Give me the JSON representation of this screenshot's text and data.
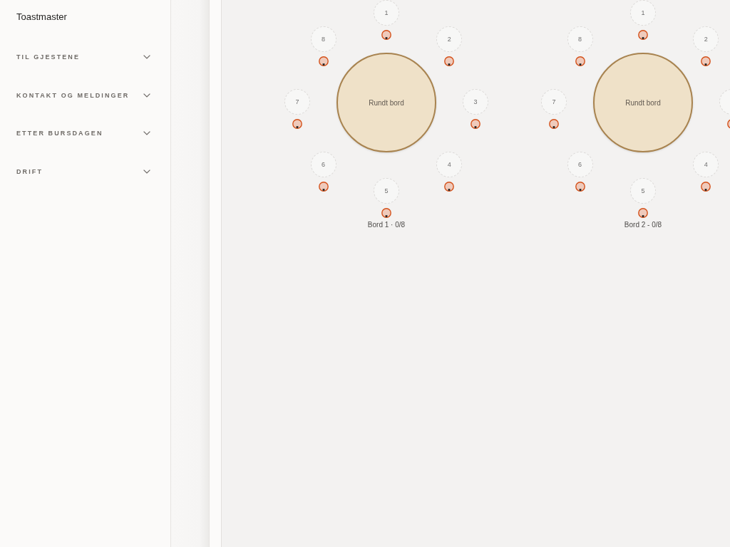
{
  "sidebar": {
    "title": "Toastmaster",
    "sections": [
      {
        "label": "TIL GJESTENE",
        "expanded": false
      },
      {
        "label": "KONTAKT OG MELDINGER",
        "expanded": false
      },
      {
        "label": "ETTER BURSDAGEN",
        "expanded": false
      },
      {
        "label": "DRIFT",
        "expanded": false
      }
    ]
  },
  "tables": [
    {
      "shape_label": "Rundt bord",
      "caption": "Bord 1 · 0/8",
      "seats": [
        {
          "number": "1",
          "occupied": false
        },
        {
          "number": "2",
          "occupied": false
        },
        {
          "number": "3",
          "occupied": false
        },
        {
          "number": "4",
          "occupied": false
        },
        {
          "number": "5",
          "occupied": false
        },
        {
          "number": "6",
          "occupied": false
        },
        {
          "number": "7",
          "occupied": false
        },
        {
          "number": "8",
          "occupied": false
        }
      ]
    },
    {
      "shape_label": "Rundt bord",
      "caption": "Bord 2 - 0/8",
      "seats": [
        {
          "number": "1",
          "occupied": false
        },
        {
          "number": "2",
          "occupied": false
        },
        {
          "occupied": false
        },
        {
          "number": "4",
          "occupied": false
        },
        {
          "number": "5",
          "occupied": false
        },
        {
          "number": "6",
          "occupied": false
        },
        {
          "number": "7",
          "occupied": false
        },
        {
          "number": "8",
          "occupied": false
        }
      ]
    }
  ]
}
